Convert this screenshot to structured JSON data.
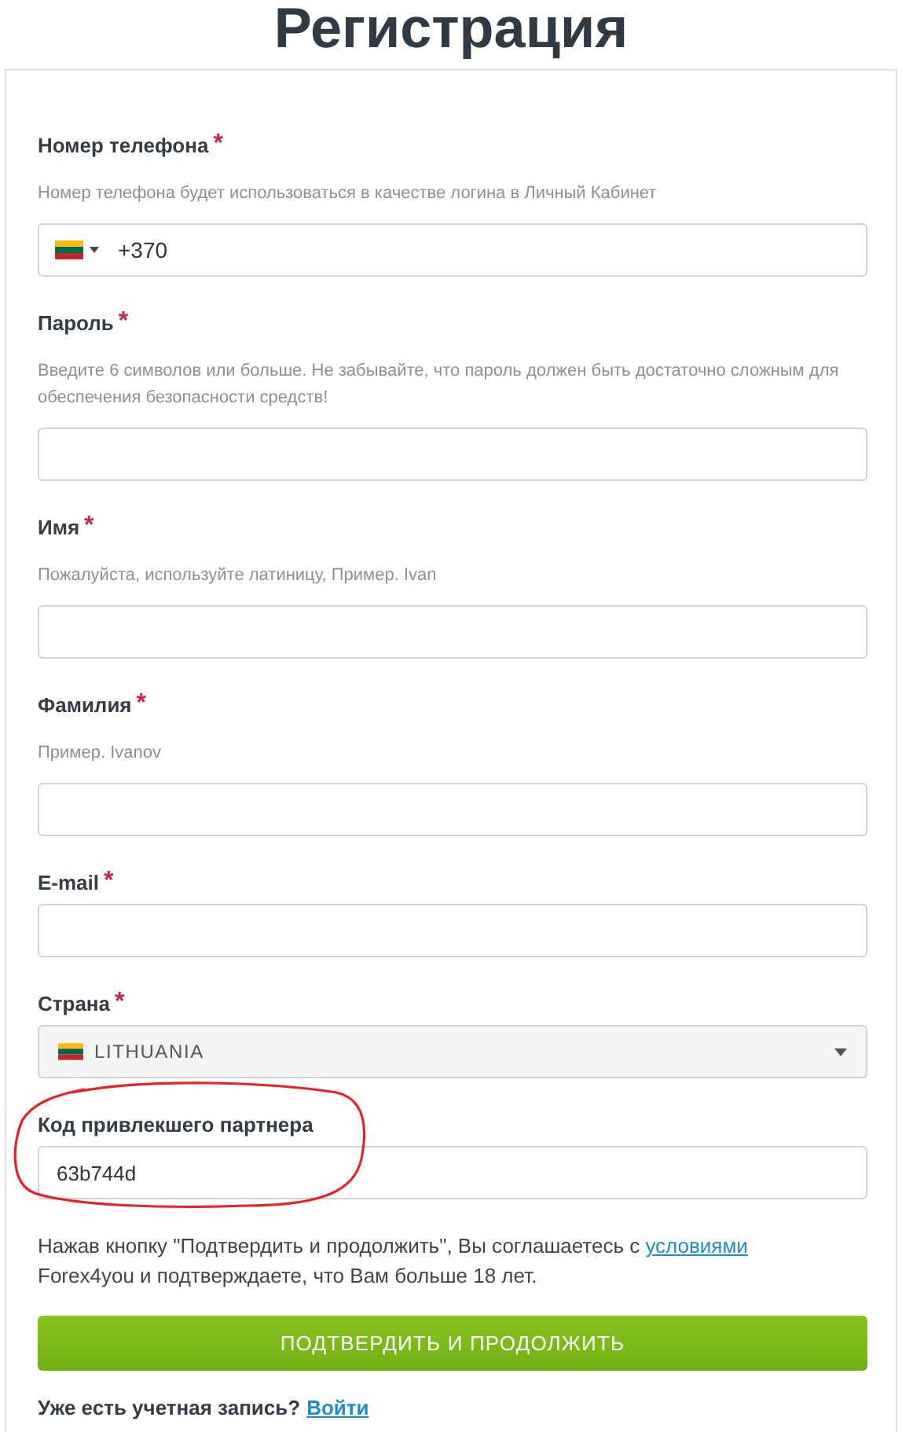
{
  "title": "Регистрация",
  "fields": [
    {
      "kind": "phone",
      "label": "Номер телефона",
      "required_mark": "*",
      "hint": "Номер телефона будет использоваться в качестве логина в Личный Кабинет",
      "value": "+370"
    },
    {
      "kind": "text",
      "label": "Пароль",
      "required_mark": "*",
      "hint": "Введите 6 символов или больше. Не забывайте, что пароль должен быть достаточно сложным для обеспечения безопасности средств!"
    },
    {
      "kind": "text",
      "label": "Имя",
      "required_mark": "*",
      "hint": "Пожалуйста, используйте латиницу, Пример. Ivan"
    },
    {
      "kind": "text",
      "label": "Фамилия",
      "required_mark": "*",
      "hint": "Пример. Ivanov"
    },
    {
      "kind": "text",
      "label": "E-mail",
      "required_mark": "*"
    },
    {
      "kind": "select",
      "label": "Страна",
      "required_mark": "*",
      "value": "LITHUANIA"
    },
    {
      "kind": "text",
      "label": "Код привлекшего партнера",
      "value": "63b744d",
      "circled": true
    }
  ],
  "terms": {
    "before": "Нажав кнопку \"Подтвердить и продолжить\", Вы соглашаетесь с ",
    "link": "условиями",
    "after": " Forex4you и подтверждаете, что Вам больше 18 лет."
  },
  "submit": "ПОДТВЕРДИТЬ И ПРОДОЛЖИТЬ",
  "login": {
    "text": "Уже есть учетная запись?",
    "link": "Войти"
  }
}
